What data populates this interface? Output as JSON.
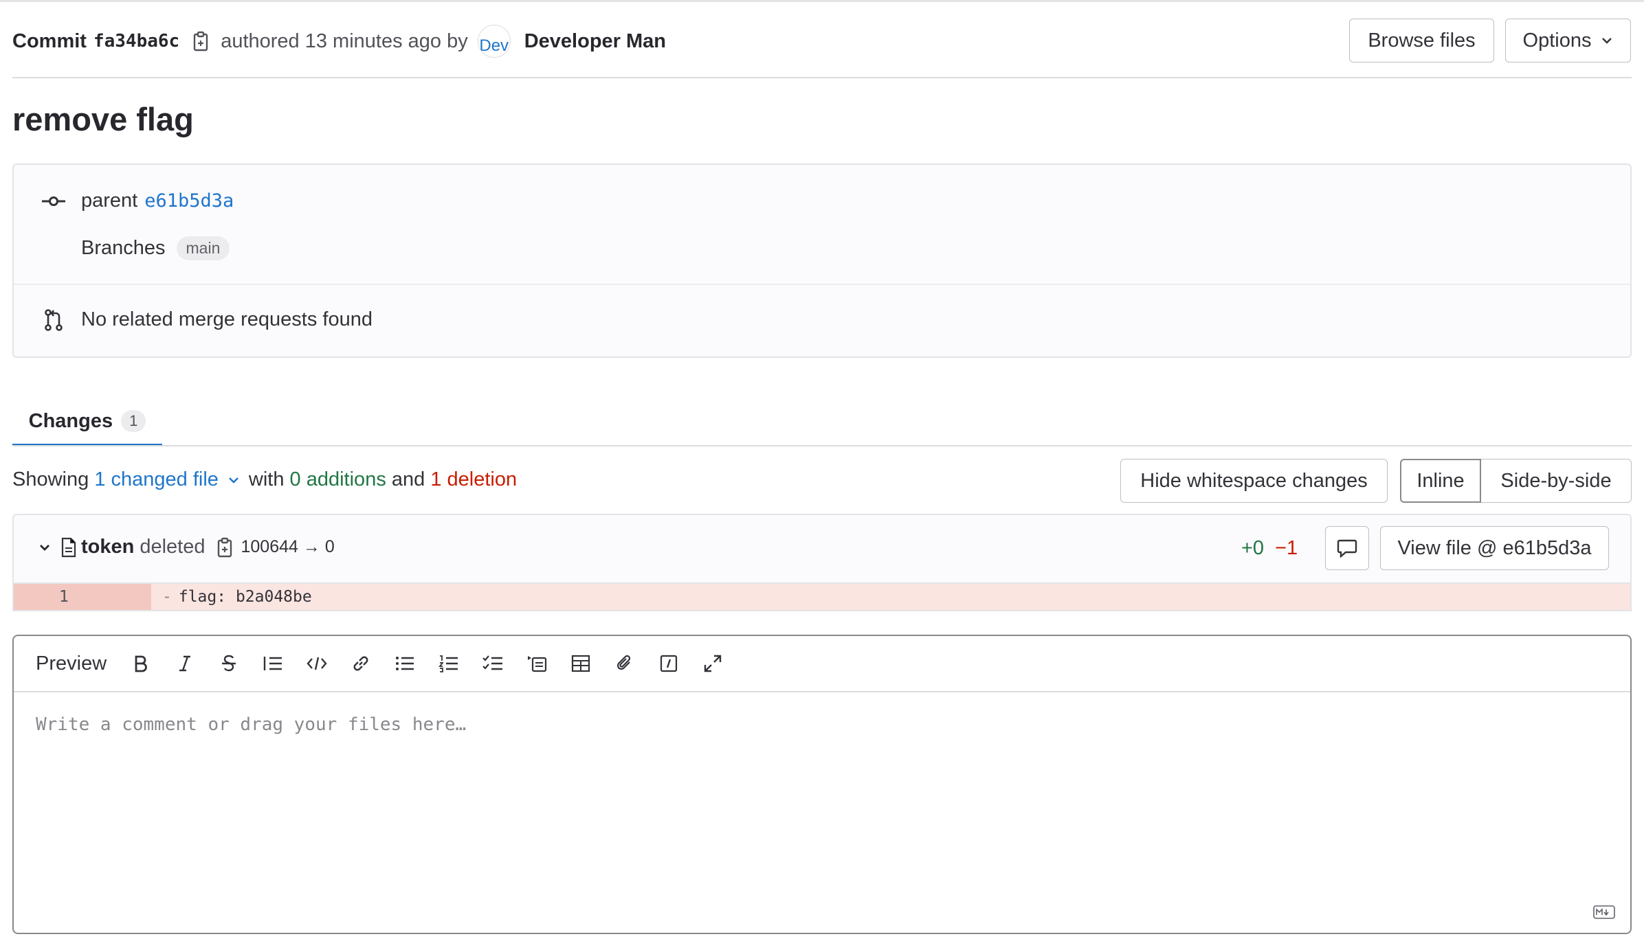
{
  "header": {
    "commit_label": "Commit",
    "sha": "fa34ba6c",
    "authored_text": "authored 13 minutes ago by",
    "avatar_text": "Dev",
    "author": "Developer Man",
    "browse_button": "Browse files",
    "options_button": "Options"
  },
  "commit": {
    "title": "remove flag",
    "parent_label": "parent",
    "parent_sha": "e61b5d3a",
    "branches_label": "Branches",
    "branch": "main",
    "merge_requests": "No related merge requests found"
  },
  "tabs": [
    {
      "label": "Changes",
      "count": "1"
    }
  ],
  "summary": {
    "showing": "Showing",
    "changed_files": "1 changed file",
    "with": "with",
    "additions": "0 additions",
    "and": "and",
    "deletions": "1 deletion",
    "hide_whitespace": "Hide whitespace changes",
    "inline": "Inline",
    "side_by_side": "Side-by-side"
  },
  "file": {
    "name": "token",
    "status": "deleted",
    "mode": "100644 → 0",
    "added": "+0",
    "removed": "−1",
    "view_file": "View file @ e61b5d3a",
    "lines": [
      {
        "old_line": "1",
        "prefix": "-",
        "content": "flag: b2a048be"
      }
    ]
  },
  "editor": {
    "preview_label": "Preview",
    "placeholder": "Write a comment or drag your files here…",
    "toolbar_icons": [
      "bold-icon",
      "italic-icon",
      "strikethrough-icon",
      "quote-icon",
      "code-icon",
      "link-icon",
      "bullet-list-icon",
      "numbered-list-icon",
      "task-list-icon",
      "collapsible-icon",
      "table-icon",
      "attach-icon",
      "quick-action-icon",
      "fullscreen-icon"
    ]
  },
  "colors": {
    "link": "#1f75cb",
    "addition": "#217645",
    "deletion": "#c91c00",
    "deleted_line_bg": "#fbe5e1"
  }
}
